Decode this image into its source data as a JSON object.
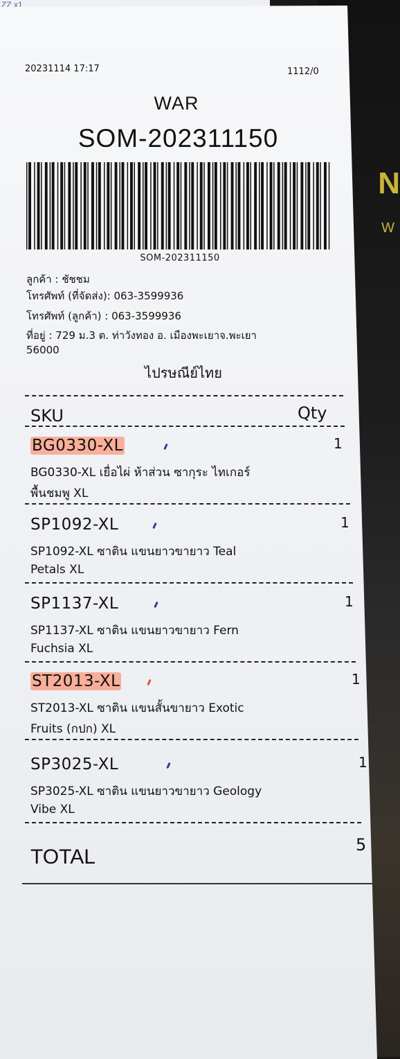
{
  "background": {
    "brand_partial": "N",
    "brand_sub_partial": "W",
    "scribble": "ZZ x1"
  },
  "receipt": {
    "datetime": "20231114 17:17",
    "code_top_right": "1112/0",
    "shop": "WAR",
    "order_id": "SOM-202311150",
    "barcode_text": "SOM-202311150",
    "customer_line": "ลูกค้า : ชัชชม",
    "phone_shipping": "โทรศัพท์ (ที่จัดส่ง): 063-3599936",
    "phone_customer": "โทรศัพท์ (ลูกค้า) : 063-3599936",
    "address_line1": "ที่อยู่ : 729 ม.3 ต. ท่าวังทอง อ. เมืองพะเยาจ.พะเยา",
    "address_line2": "56000",
    "carrier": "ไปรษณีย์ไทย",
    "col_sku": "SKU",
    "col_qty": "Qty",
    "items": [
      {
        "sku": "BG0330-XL",
        "qty": "1",
        "desc1": "BG0330-XL เยื่อไผ่ ห้าส่วน ซากุระ ไทเกอร์",
        "desc2": "พื้นชมพู XL",
        "highlight": true,
        "tick_color": "#2a3b9a"
      },
      {
        "sku": "SP1092-XL",
        "qty": "1",
        "desc1": "SP1092-XL ซาติน แขนยาวขายาว Teal",
        "desc2": "Petals XL",
        "highlight": false,
        "tick_color": "#2a3b9a"
      },
      {
        "sku": "SP1137-XL",
        "qty": "1",
        "desc1": "SP1137-XL ซาติน แขนยาวขายาว Fern",
        "desc2": "Fuchsia XL",
        "highlight": false,
        "tick_color": "#2a3b9a"
      },
      {
        "sku": "ST2013-XL",
        "qty": "1",
        "desc1": "ST2013-XL ซาติน แขนสั้นขายาว Exotic",
        "desc2": "Fruits (กปก) XL",
        "highlight": true,
        "tick_color": "#e0532d"
      },
      {
        "sku": "SP3025-XL",
        "qty": "1",
        "desc1": "SP3025-XL ซาติน แขนยาวขายาว Geology",
        "desc2": "Vibe XL",
        "highlight": false,
        "tick_color": "#2a3b9a"
      }
    ],
    "total_label": "TOTAL",
    "total_value": "5"
  },
  "colors": {
    "highlighter": "#ff7850",
    "pen_blue": "#2a3b9a",
    "paper": "#f3f4f7"
  }
}
